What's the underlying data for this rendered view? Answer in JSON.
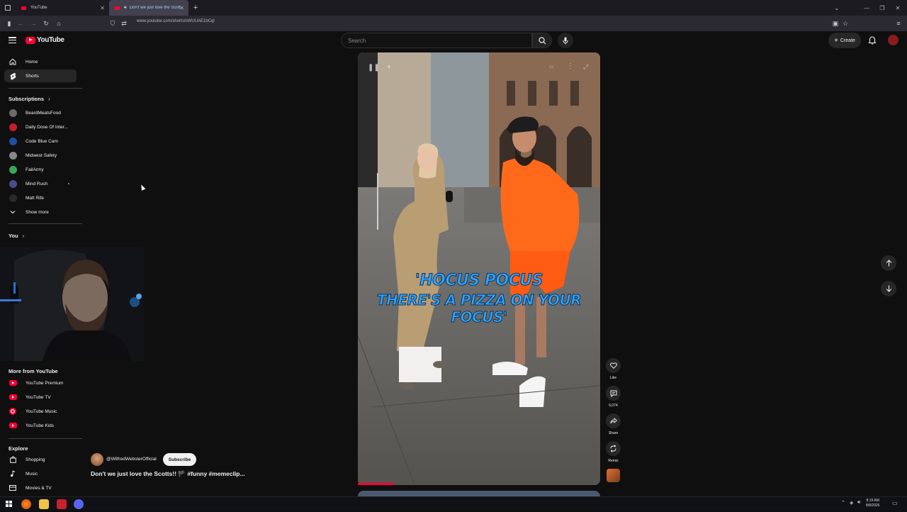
{
  "browser": {
    "tabs": [
      {
        "label": "YouTube",
        "active": false
      },
      {
        "label": "Don't we just love the Scott",
        "active": true
      }
    ],
    "url": "www.youtube.com/shorts/nWUUAE1bCql"
  },
  "masthead": {
    "logo_text": "YouTube",
    "search_placeholder": "Search",
    "create_label": "Create"
  },
  "sidebar": {
    "main": [
      {
        "label": "Home",
        "icon": "home-icon"
      },
      {
        "label": "Shorts",
        "icon": "shorts-icon",
        "active": true
      }
    ],
    "subscriptions_header": "Subscriptions",
    "subscriptions": [
      {
        "label": "BeardMeatsFood",
        "color": "#6b6b6b"
      },
      {
        "label": "Daily Dose Of Inter...",
        "color": "#c81e2a"
      },
      {
        "label": "Code Blue Cam",
        "color": "#1f4fa0"
      },
      {
        "label": "Midwest Safety",
        "color": "#888888"
      },
      {
        "label": "FailArmy",
        "color": "#3aa657"
      },
      {
        "label": "Mind Rush",
        "color": "#4b4b8a"
      },
      {
        "label": "Matt Rife",
        "color": "#2a2a2a"
      }
    ],
    "show_more": "Show more",
    "you_header": "You",
    "more_header": "More from YouTube",
    "more": [
      {
        "label": "YouTube Premium"
      },
      {
        "label": "YouTube TV"
      },
      {
        "label": "YouTube Music"
      },
      {
        "label": "YouTube Kids"
      }
    ],
    "explore_header": "Explore",
    "explore": [
      {
        "label": "Shopping",
        "icon": "shopping-bag-icon"
      },
      {
        "label": "Music",
        "icon": "music-note-icon"
      },
      {
        "label": "Movies & TV",
        "icon": "film-icon"
      }
    ]
  },
  "short": {
    "caption_line1": "'HOCUS POCUS",
    "caption_line2": "THERE'S A PIZZA ON YOUR FOCUS'",
    "progress": 0.15,
    "channel": "@WilfredWebsterOfficial",
    "subscribe_label": "Subscribe",
    "title": "Don't we just love the Scotts!! 🏴 #funny #memeclip..."
  },
  "actions": {
    "like_label": "Like",
    "comments_count": "6,074",
    "share_label": "Share",
    "remix_label": "Remix"
  },
  "taskbar": {
    "time": "8:19 AM",
    "date": "8/8/2026"
  },
  "colors": {
    "accent": "#ff0033",
    "background": "#0f0f0f",
    "caption": "#2ba8ff"
  }
}
